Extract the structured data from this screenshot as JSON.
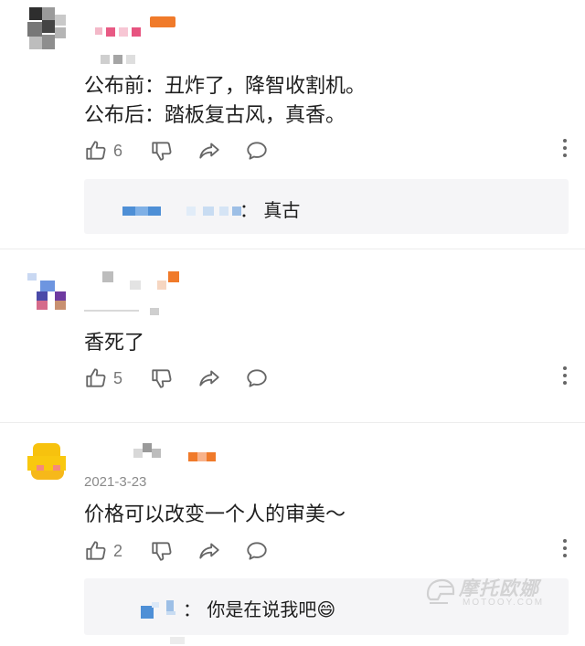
{
  "comments": [
    {
      "date": "",
      "lines": [
        "公布前：丑炸了，降智收割机。",
        "公布后：踏板复古风，真香。"
      ],
      "likes": "6",
      "reply": {
        "text": "：  真古"
      }
    },
    {
      "date": "",
      "lines": [
        "香死了"
      ],
      "likes": "5"
    },
    {
      "date": "2021-3-23",
      "lines": [
        "价格可以改变一个人的审美～"
      ],
      "likes": "2",
      "reply": {
        "text": "：  你是在说我吧😄"
      }
    }
  ],
  "icons": {
    "like": "thumbs-up-icon",
    "dislike": "thumbs-down-icon",
    "share": "share-arrow-icon",
    "reply": "speech-bubble-icon",
    "more": "more-vertical-icon"
  },
  "watermark": {
    "main": "摩托欧娜",
    "sub": "MOTOOY.COM"
  },
  "colors": {
    "text": "#1e1e1e",
    "muted": "#8a8a8a",
    "reply_bg": "#f5f5f7",
    "divider": "#ececec",
    "name_blue": "#4e8fd6",
    "badge_orange": "#f07a2a"
  }
}
